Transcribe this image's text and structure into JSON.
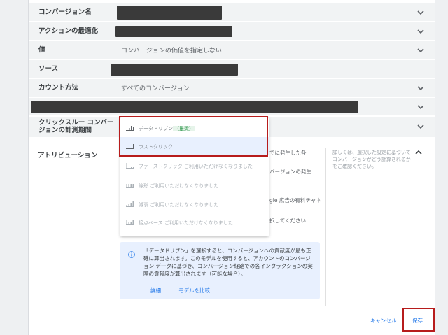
{
  "rows": [
    {
      "label": "コンバージョン名",
      "value": ""
    },
    {
      "label": "アクションの最適化",
      "value": ""
    },
    {
      "label": "値",
      "value": "コンバージョンの価値を指定しない"
    },
    {
      "label": "ソース",
      "value": ""
    },
    {
      "label": "カウント方法",
      "value": "すべてのコンバージョン"
    },
    {
      "label": "",
      "value": ""
    },
    {
      "label": "クリックスルー コンバー\nジョンの計測期間",
      "value": ""
    }
  ],
  "attribution": {
    "title": "アトリビューション",
    "side_note": "詳しくは、選択した設定に基づいてコンバージョンがどう計算されるかをご確認ください。",
    "bg_lines": [
      "でに発生した各",
      "バージョンの発生",
      "gle 広告の有料チャネ",
      "択してください"
    ]
  },
  "dropdown": {
    "options": [
      {
        "label": "データドリブン",
        "badge": "（推奨）",
        "note": "",
        "disabled": false
      },
      {
        "label": "ラストクリック",
        "badge": "",
        "note": "",
        "disabled": false
      },
      {
        "label": "ファーストクリック",
        "badge": "",
        "note": "ご利用いただけなくなりました",
        "disabled": true
      },
      {
        "label": "線形",
        "badge": "",
        "note": "ご利用いただけなくなりました",
        "disabled": true
      },
      {
        "label": "減衰",
        "badge": "",
        "note": "ご利用いただけなくなりました",
        "disabled": true
      },
      {
        "label": "接点ベース",
        "badge": "",
        "note": "ご利用いただけなくなりました",
        "disabled": true
      }
    ]
  },
  "info": {
    "text": "「データドリブン」を選択すると、コンバージョンへの貢献度が最も正確に算出されます。このモデルを使用すると、アカウントのコンバージョン データに基づき、コンバージョン経路での各インタラクションの実際の貢献度が算出されます（可能な場合）。",
    "link_details": "詳細",
    "link_compare": "モデルを比較"
  },
  "footer": {
    "cancel": "キャンセル",
    "save": "保存"
  },
  "colors": {
    "highlight": "#b71c1c",
    "link": "#1a73e8",
    "info_bg": "#e8f0fe",
    "row_bg": "#f1f3f4"
  }
}
